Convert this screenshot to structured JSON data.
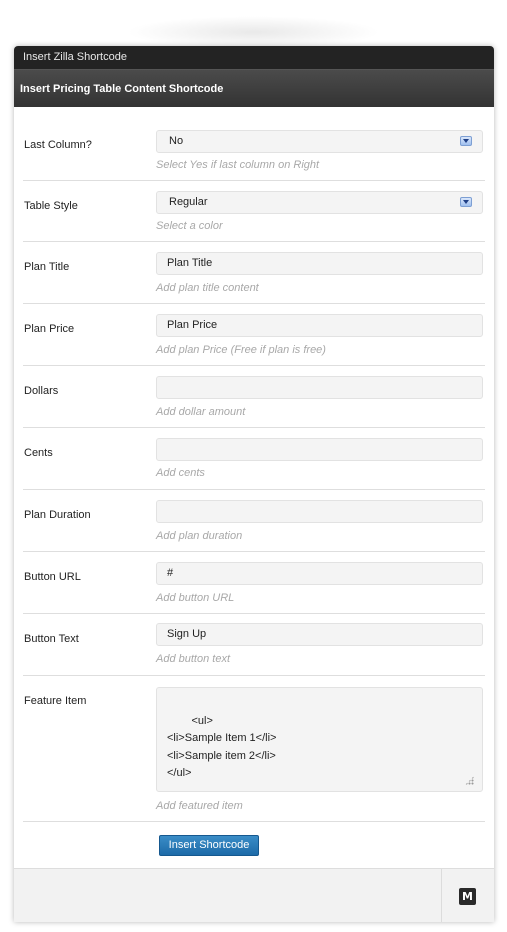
{
  "window": {
    "title": "Insert Zilla Shortcode",
    "subtitle": "Insert Pricing Table Content Shortcode"
  },
  "form": {
    "last_column": {
      "label": "Last Column?",
      "value": "No",
      "help": "Select Yes if last column on Right"
    },
    "table_style": {
      "label": "Table Style",
      "value": "Regular",
      "help": "Select a color"
    },
    "plan_title": {
      "label": "Plan Title",
      "value": "Plan Title",
      "help": "Add plan title content"
    },
    "plan_price": {
      "label": "Plan Price",
      "value": "Plan Price",
      "help": "Add plan Price (Free if plan is free)"
    },
    "dollars": {
      "label": "Dollars",
      "value": "",
      "help": "Add dollar amount"
    },
    "cents": {
      "label": "Cents",
      "value": "",
      "help": "Add cents"
    },
    "plan_duration": {
      "label": "Plan Duration",
      "value": "",
      "help": "Add plan duration"
    },
    "button_url": {
      "label": "Button URL",
      "value": "#",
      "help": "Add button URL"
    },
    "button_text": {
      "label": "Button Text",
      "value": "Sign Up",
      "help": "Add button text"
    },
    "feature_item": {
      "label": "Feature Item",
      "value": "<ul>\n<li>Sample Item 1</li>\n<li>Sample item 2</li>\n</ul>",
      "help": "Add featured item"
    }
  },
  "actions": {
    "insert_label": "Insert Shortcode"
  },
  "footer": {
    "icon_letter": "M"
  },
  "colors": {
    "primary_button": "#1d6aa8",
    "titlebar": "#232323",
    "help_text": "#a8a8a8"
  }
}
